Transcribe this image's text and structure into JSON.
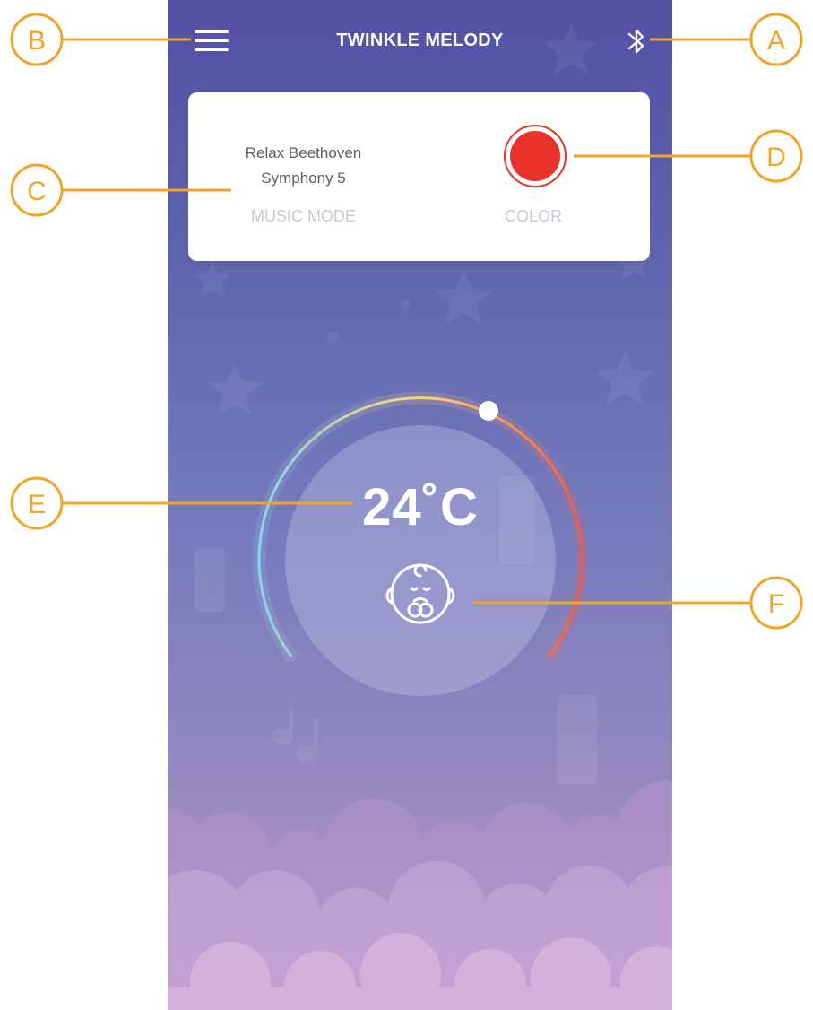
{
  "app": {
    "title": "TWINKLE MELODY"
  },
  "header": {
    "menu_icon": "hamburger-menu-icon",
    "bluetooth_icon": "bluetooth-icon"
  },
  "card": {
    "song_line1": "Relax Beethoven",
    "song_line2": "Symphony 5",
    "mode_label": "MUSIC MODE",
    "color_label": "COLOR",
    "selected_color": "#e8322a"
  },
  "dial": {
    "temperature": "24˚C",
    "baby_icon": "baby-face-icon"
  },
  "callouts": {
    "A": "A",
    "B": "B",
    "C": "C",
    "D": "D",
    "E": "E",
    "F": "F"
  },
  "colors": {
    "callout": "#f0a52a",
    "bg_top": "#5450a4",
    "bg_bottom": "#c9a7d3"
  }
}
